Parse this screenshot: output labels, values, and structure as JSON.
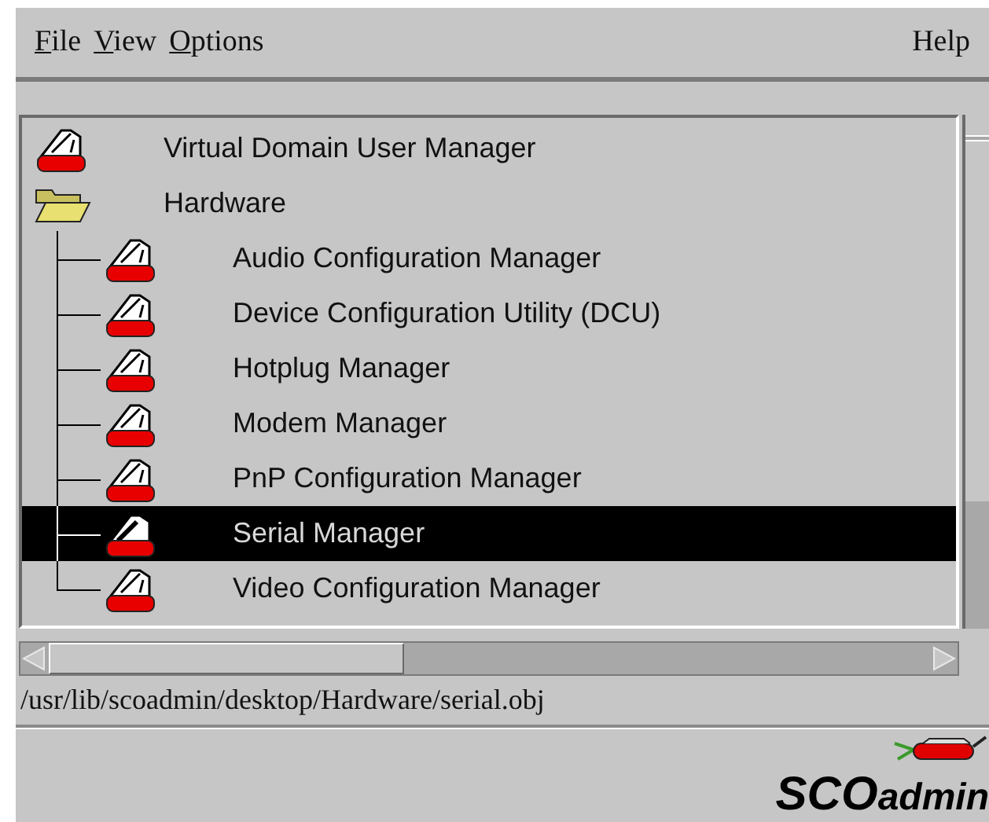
{
  "menu": [
    {
      "label": "File"
    },
    {
      "label": "View"
    },
    {
      "label": "Options"
    }
  ],
  "help_menu": {
    "label": "Help"
  },
  "tree": [
    {
      "label": "Virtual Domain User Manager",
      "kind": "app",
      "selected": false
    },
    {
      "label": "Hardware",
      "kind": "folder",
      "selected": false,
      "expanded": true,
      "children": [
        {
          "label": "Audio Configuration Manager",
          "kind": "app",
          "selected": false
        },
        {
          "label": "Device Configuration Utility (DCU)",
          "kind": "app",
          "selected": false
        },
        {
          "label": "Hotplug Manager",
          "kind": "app",
          "selected": false
        },
        {
          "label": "Modem Manager",
          "kind": "app",
          "selected": false
        },
        {
          "label": "PnP Configuration Manager",
          "kind": "app",
          "selected": false
        },
        {
          "label": "Serial Manager",
          "kind": "app",
          "selected": true
        },
        {
          "label": "Video Configuration Manager",
          "kind": "app",
          "selected": false
        }
      ]
    }
  ],
  "status_path": "/usr/lib/scoadmin/desktop/Hardware/serial.obj",
  "logo": {
    "brand": "SCO",
    "product": "admin"
  }
}
